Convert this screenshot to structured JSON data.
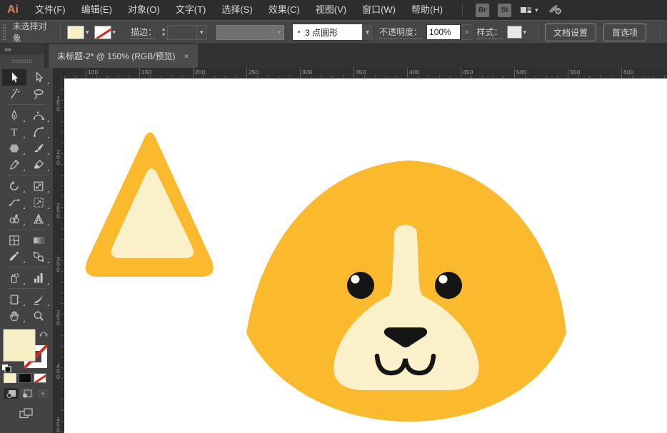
{
  "menu_bar": {
    "logo": "Ai",
    "items": [
      "文件(F)",
      "编辑(E)",
      "对象(O)",
      "文字(T)",
      "选择(S)",
      "效果(C)",
      "视图(V)",
      "窗口(W)",
      "帮助(H)"
    ],
    "bridge_button": "Br",
    "stock_button": "St"
  },
  "control_bar": {
    "status": "未选择对象",
    "stroke_label": "描边：",
    "brush_bullet": "•",
    "brush_value": "3 点圆形",
    "opacity_label": "不透明度：",
    "opacity_value": "100%",
    "expand_button": ">",
    "style_label": "样式：",
    "document_setup_button": "文档设置",
    "preferences_button": "首选项"
  },
  "panel_header": {
    "collapse_glyph": "««"
  },
  "document_tab": {
    "title": "未标题-2* @ 150% (RGB/预览)",
    "close": "×"
  },
  "toolbar": {
    "tools": [
      {
        "name": "selection",
        "active": true
      },
      {
        "name": "direct-selection",
        "flyout": true
      },
      {
        "name": "magic-wand"
      },
      {
        "name": "lasso"
      },
      {
        "sep": true
      },
      {
        "name": "pen",
        "flyout": true
      },
      {
        "name": "curvature",
        "flyout": true
      },
      {
        "name": "type",
        "flyout": true
      },
      {
        "name": "arc",
        "flyout": true
      },
      {
        "name": "polygon",
        "flyout": true
      },
      {
        "name": "paintbrush",
        "flyout": true
      },
      {
        "name": "shaper",
        "flyout": true
      },
      {
        "name": "eraser",
        "flyout": true
      },
      {
        "sep": true
      },
      {
        "name": "rotate",
        "flyout": true
      },
      {
        "name": "scale",
        "flyout": true
      },
      {
        "name": "width",
        "flyout": true
      },
      {
        "name": "free-transform",
        "flyout": true
      },
      {
        "name": "shape-builder",
        "flyout": true
      },
      {
        "name": "perspective-grid",
        "flyout": true
      },
      {
        "sep": true
      },
      {
        "name": "mesh"
      },
      {
        "name": "gradient"
      },
      {
        "name": "eyedropper",
        "flyout": true
      },
      {
        "name": "blend",
        "flyout": true
      },
      {
        "sep": true
      },
      {
        "name": "symbol-sprayer",
        "flyout": true
      },
      {
        "name": "column-graph",
        "flyout": true
      },
      {
        "sep": true
      },
      {
        "name": "artboard",
        "flyout": true
      },
      {
        "name": "slice",
        "flyout": true
      },
      {
        "name": "hand",
        "flyout": true
      },
      {
        "name": "zoom"
      }
    ],
    "drawing_modes": [
      "draw-normal",
      "draw-behind",
      "draw-inside"
    ]
  },
  "rulers": {
    "horizontal_labels": [
      100,
      150,
      200,
      250,
      300,
      350,
      400,
      450,
      500,
      550,
      600
    ],
    "vertical_labels": [
      150,
      200,
      250,
      300,
      350,
      400,
      450
    ]
  },
  "colors": {
    "artwork_yellow": "#FBB92D",
    "artwork_cream": "#FAF1CA",
    "artwork_black": "#151515",
    "eye_highlight": "#FFFFFF",
    "fill_swatch": "#F8EFC5",
    "stroke_none_red": "#E1251B",
    "canvas_white": "#FFFFFF"
  }
}
